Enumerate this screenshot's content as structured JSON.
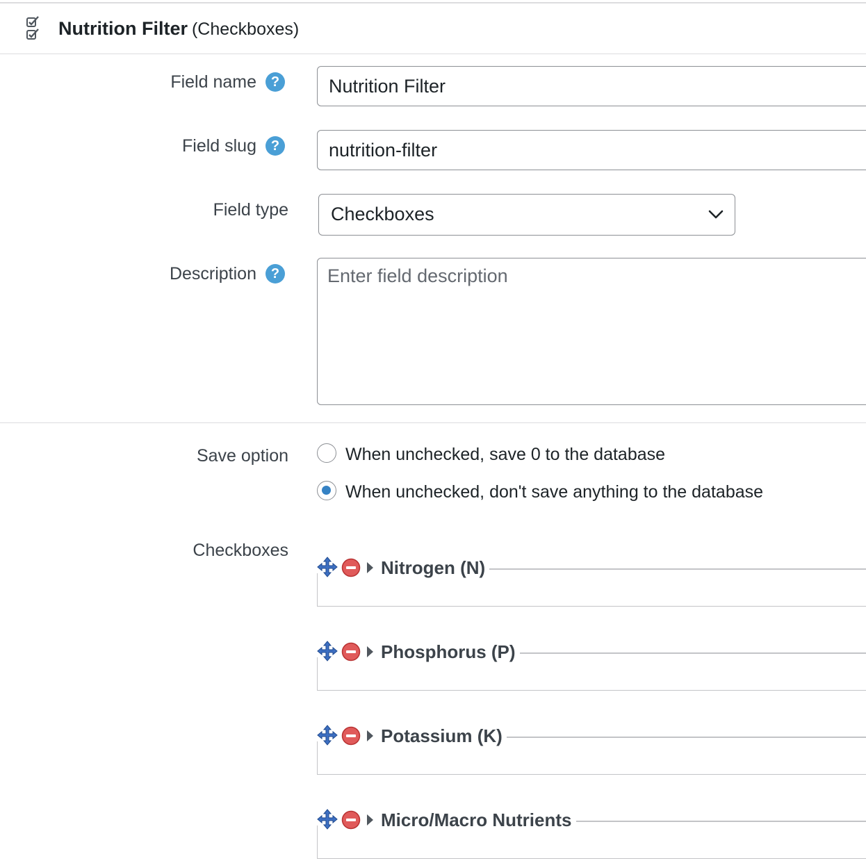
{
  "header": {
    "field_name": "Nutrition Filter",
    "field_type_label": "(Checkboxes)",
    "icon": "checkboxes-icon"
  },
  "form": {
    "field_name": {
      "label": "Field name",
      "value": "Nutrition Filter"
    },
    "field_slug": {
      "label": "Field slug",
      "value": "nutrition-filter"
    },
    "field_type": {
      "label": "Field type",
      "selected": "Checkboxes"
    },
    "description": {
      "label": "Description",
      "value": "",
      "placeholder": "Enter field description"
    },
    "help_glyph": "?",
    "save_option": {
      "label": "Save option",
      "options": [
        {
          "label": "When unchecked, save 0 to the database",
          "selected": false
        },
        {
          "label": "When unchecked, don't save anything to the database",
          "selected": true
        }
      ]
    },
    "checkboxes": {
      "label": "Checkboxes",
      "items": [
        {
          "title": "Nitrogen (N)"
        },
        {
          "title": "Phosphorus (P)"
        },
        {
          "title": "Potassium (K)"
        },
        {
          "title": "Micro/Macro Nutrients"
        }
      ]
    }
  },
  "colors": {
    "help_icon": "#4a9fd6",
    "radio_selected": "#3582c4",
    "move_icon": "#3d6fc2",
    "delete_icon": "#e05a5a"
  }
}
